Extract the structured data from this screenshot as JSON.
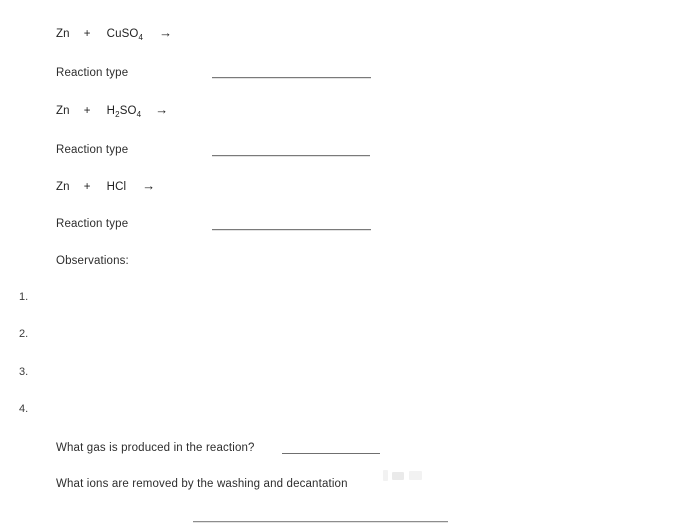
{
  "document": {
    "type": "chemistry-lab-worksheet",
    "background_color": "#ffffff",
    "text_color": "#2d2d2d",
    "rule_color": "#7a7a7a"
  },
  "equations": [
    {
      "reactant_1": "Zn",
      "plus": "+",
      "reactant_2_parts": [
        {
          "text": "CuSO",
          "sub": false
        },
        {
          "text": "4",
          "sub": true
        }
      ],
      "reactant_2_plain": "CuSO4",
      "arrow": "→"
    },
    {
      "reactant_1": "Zn",
      "plus": "+",
      "reactant_2_parts": [
        {
          "text": "H",
          "sub": false
        },
        {
          "text": "2",
          "sub": true
        },
        {
          "text": "SO",
          "sub": false
        },
        {
          "text": "4",
          "sub": true
        }
      ],
      "reactant_2_plain": "H2SO4",
      "arrow": "→"
    },
    {
      "reactant_1": "Zn",
      "plus": "+",
      "reactant_2_parts": [
        {
          "text": "HCl",
          "sub": false
        }
      ],
      "reactant_2_plain": "HCl",
      "arrow": "→"
    }
  ],
  "reaction_type_labels": [
    "Reaction type",
    "Reaction type",
    "Reaction type"
  ],
  "observations": {
    "heading": "Observations:",
    "items": [
      "1.",
      "2.",
      "3.",
      "4."
    ]
  },
  "questions": [
    {
      "text": "What gas is produced in the reaction?",
      "has_inline_blank": true
    },
    {
      "text": "What ions are removed by the washing and decantation",
      "has_inline_blank": false
    }
  ],
  "answer_rules": {
    "count": 4,
    "description": "blank horizontal answer lines"
  }
}
